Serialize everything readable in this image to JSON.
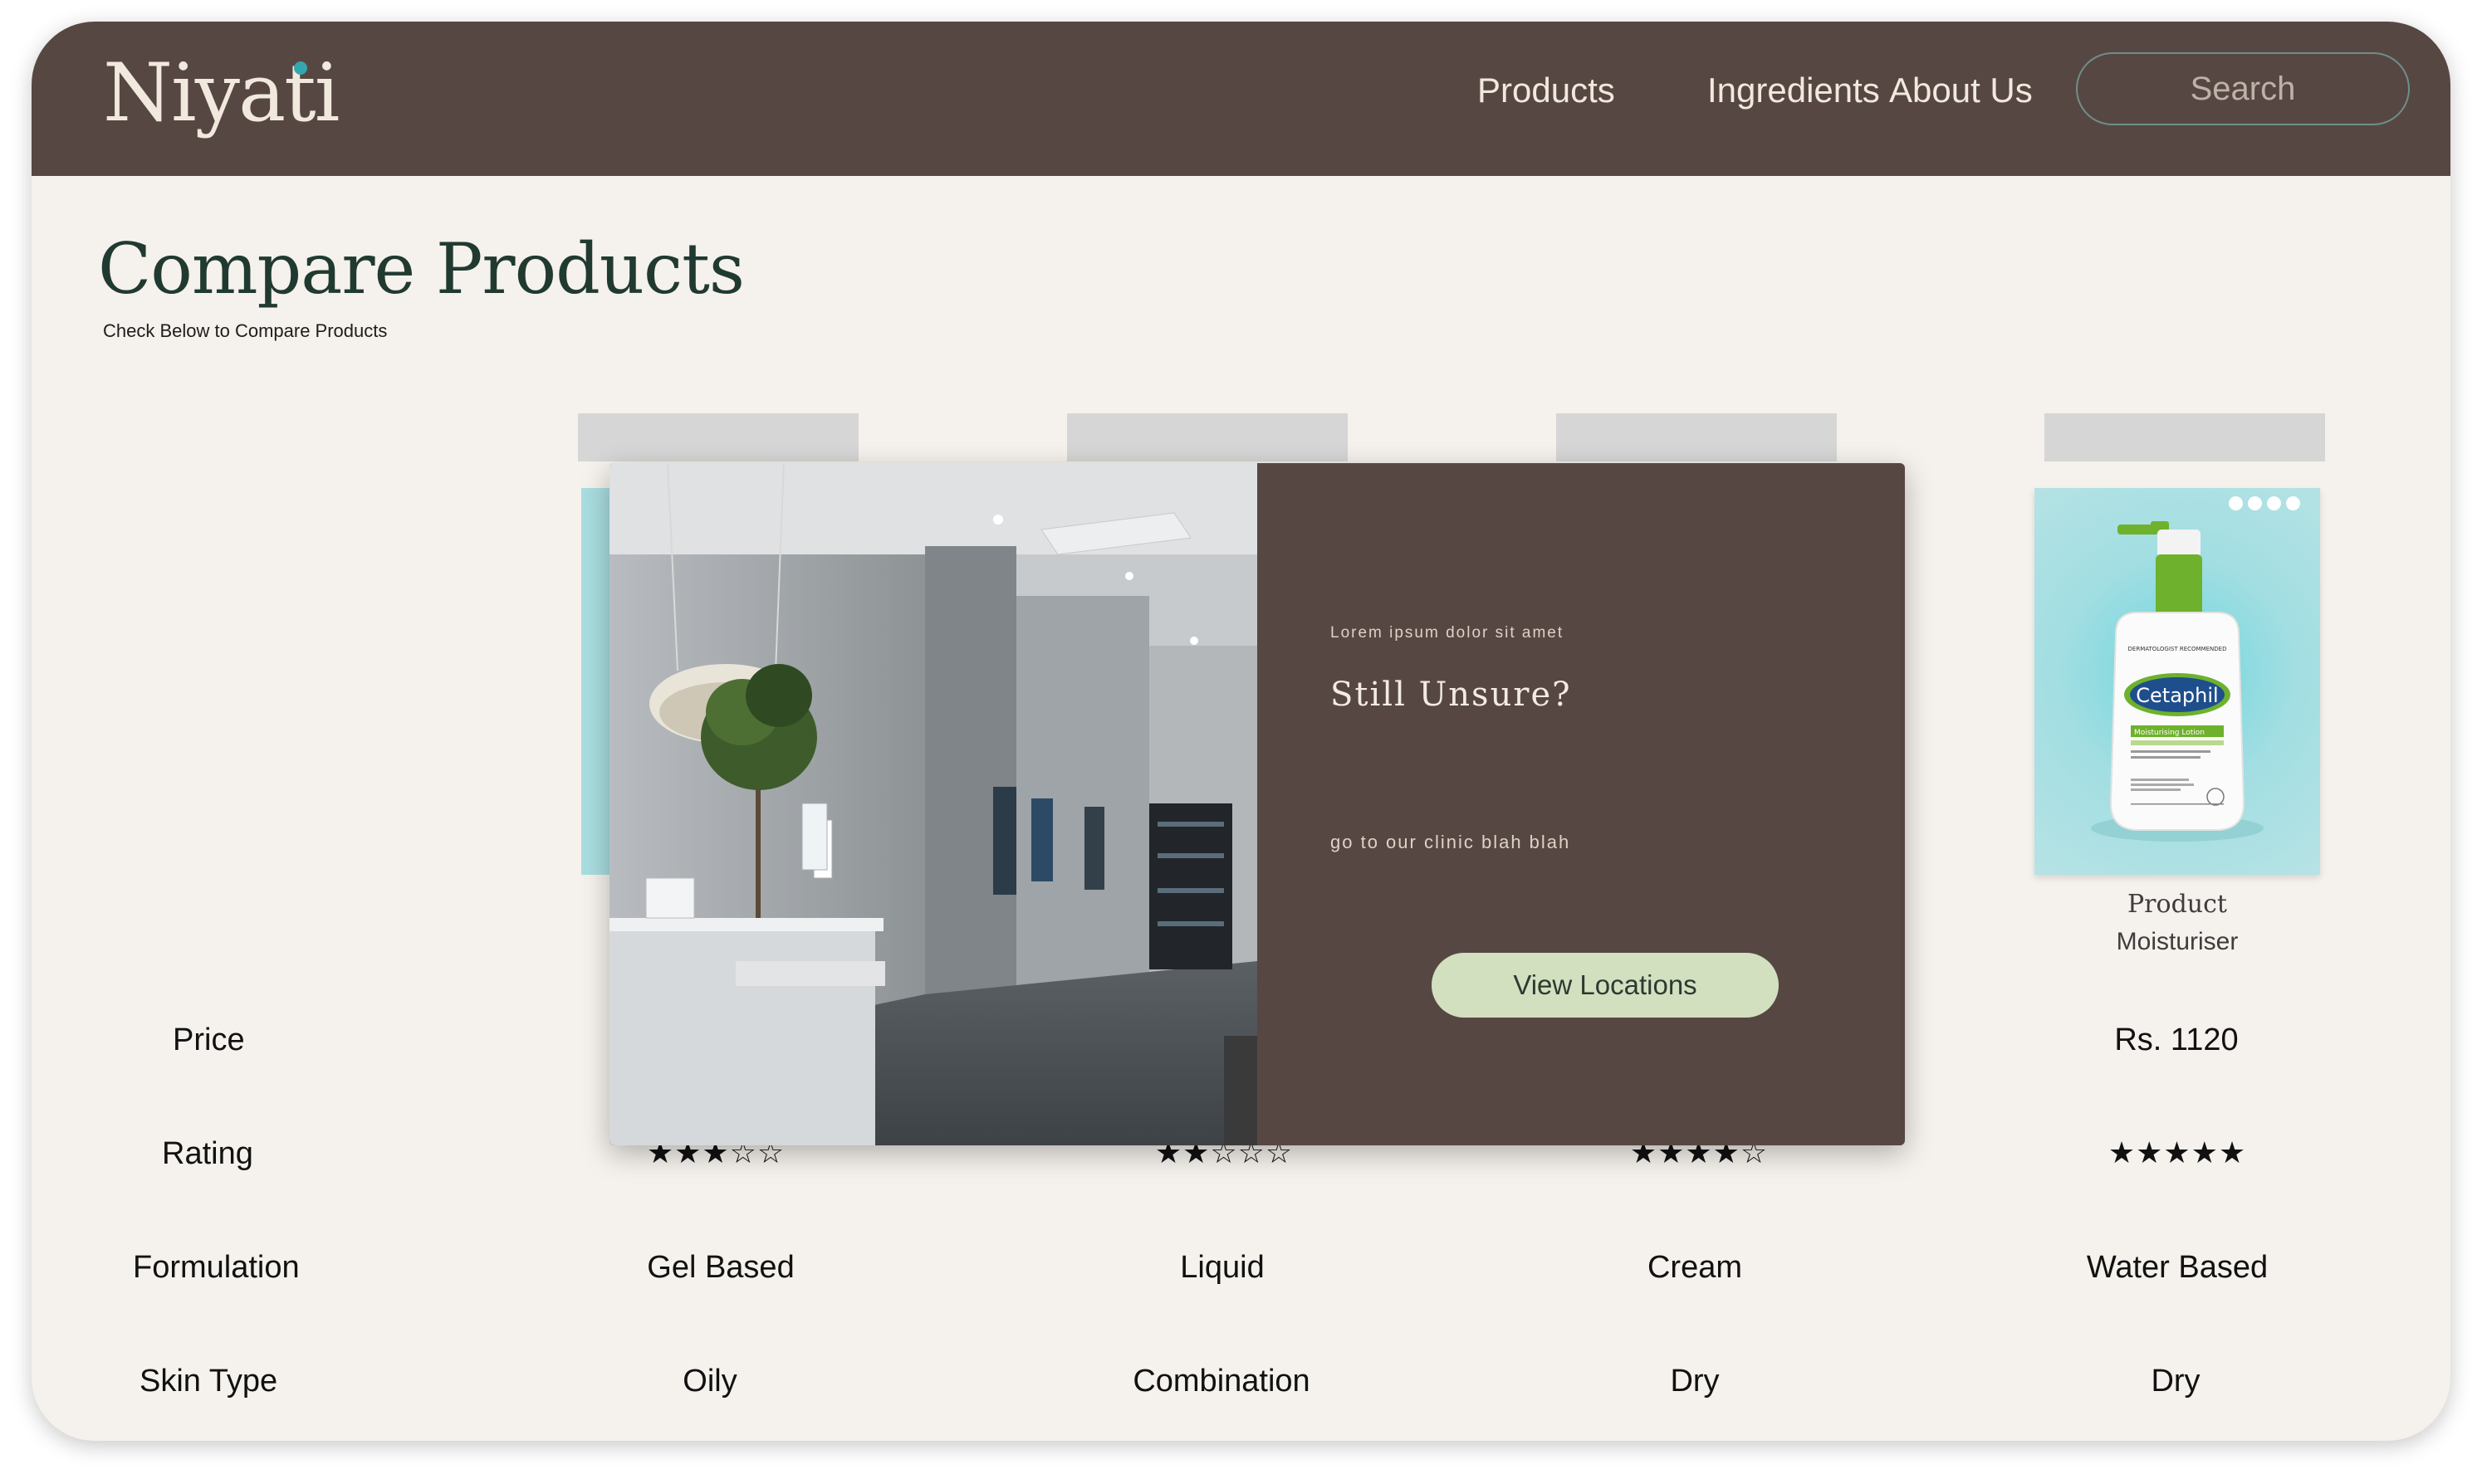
{
  "brand": {
    "name": "Niyati",
    "accent_dot_color": "#35a6ad"
  },
  "colors": {
    "nav_bg": "#574743",
    "page_bg": "#f5f1ec",
    "title": "#203a31",
    "modal_bg": "#574743",
    "modal_button_bg": "#d3e0c0",
    "card_bg": "#a9dde0"
  },
  "nav": {
    "links": [
      "Products",
      "Ingredients",
      "About Us"
    ],
    "search_placeholder": "Search"
  },
  "page": {
    "title": "Compare Products",
    "subtitle": "Check Below to Compare Products"
  },
  "product_preview": {
    "name": "Product",
    "type": "Moisturiser",
    "image_icon": "moisturiser-bottle-icon",
    "bottle_brand": "Cetaphil",
    "bottle_label_heading": "DERMATOLOGIST RECOMMENDED",
    "bottle_subtitle": "Moisturising Lotion"
  },
  "comparison": {
    "rows": [
      {
        "label": "Price",
        "values": [
          "",
          "",
          "",
          "Rs. 1120"
        ]
      },
      {
        "label": "Rating",
        "values": [
          "★★★☆☆",
          "★★☆☆☆",
          "★★★★☆",
          "★★★★★"
        ]
      },
      {
        "label": "Formulation",
        "values": [
          "Gel Based",
          "Liquid",
          "Cream",
          "Water Based"
        ]
      },
      {
        "label": "Skin Type",
        "values": [
          "Oily",
          "Combination",
          "Dry",
          "Dry"
        ]
      }
    ],
    "ratings": [
      3,
      2,
      4,
      5
    ]
  },
  "modal": {
    "kicker": "Lorem ipsum dolor sit amet",
    "title": "Still Unsure?",
    "body": "go to our clinic blah blah",
    "button": "View Locations",
    "image_icon": "clinic-interior-photo"
  }
}
